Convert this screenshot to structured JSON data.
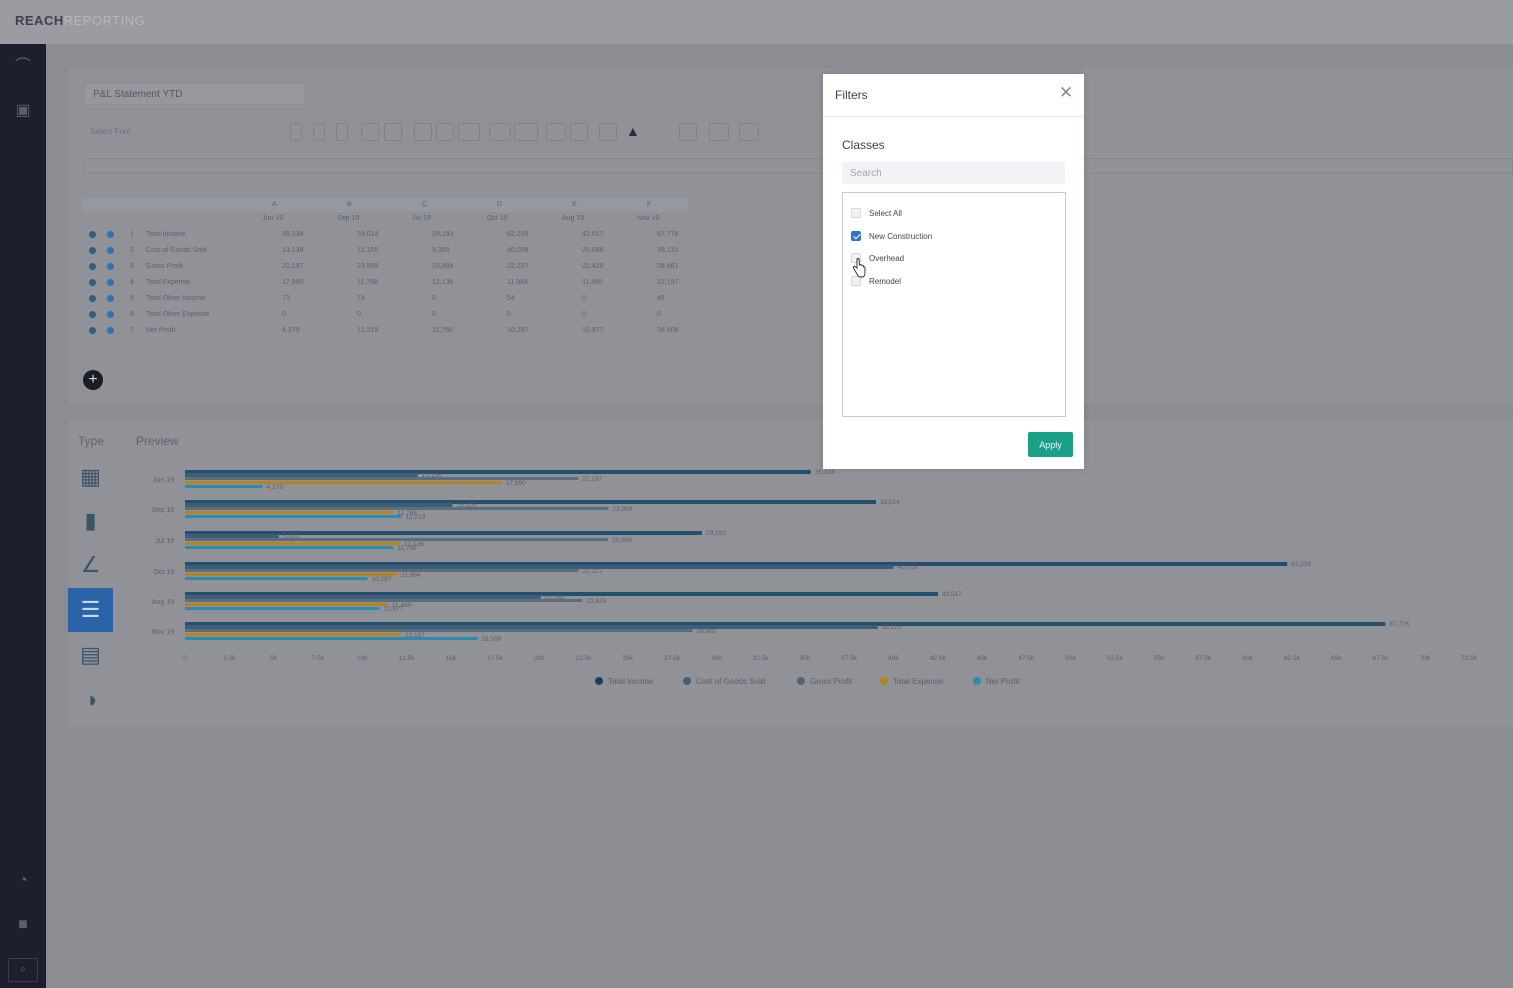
{
  "app": {
    "logo_bold": "REACH",
    "logo_light": "REPORTING"
  },
  "report": {
    "title": "P&L Statement YTD",
    "font_select": "Select Font",
    "columns": [
      "Jun 19",
      "Sep 19",
      "Jul 19",
      "Oct 19",
      "Aug 19",
      "Nov 19"
    ],
    "col_letters": [
      "A",
      "B",
      "C",
      "D",
      "E",
      "F"
    ],
    "rows": [
      {
        "n": "1",
        "label": "Total Income",
        "vals": [
          "35,334",
          "39,014",
          "29,193",
          "62,235",
          "42,517",
          "67,776"
        ]
      },
      {
        "n": "2",
        "label": "Cost of Goods Sold",
        "vals": [
          "13,138",
          "15,105",
          "5,300",
          "40,008",
          "20,088",
          "39,115"
        ]
      },
      {
        "n": "3",
        "label": "Gross Profit",
        "vals": [
          "22,197",
          "23,909",
          "23,888",
          "22,227",
          "22,429",
          "28,661"
        ]
      },
      {
        "n": "4",
        "label": "Total Expense",
        "vals": [
          "17,890",
          "11,768",
          "12,136",
          "11,984",
          "11,465",
          "12,197"
        ]
      },
      {
        "n": "5",
        "label": "Total Other Income",
        "vals": [
          "73",
          "74",
          "0",
          "54",
          "0",
          "46"
        ]
      },
      {
        "n": "6",
        "label": "Total Other Expense",
        "vals": [
          "0",
          "0",
          "0",
          "0",
          "0",
          "0"
        ]
      },
      {
        "n": "7",
        "label": "Net Profit",
        "vals": [
          "4,379",
          "12,219",
          "11,750",
          "10,297",
          "10,977",
          "16,508"
        ]
      }
    ]
  },
  "type_panel": {
    "label": "Type",
    "preview_label": "Preview"
  },
  "type_icons": [
    "table-icon",
    "bar-chart-icon",
    "line-chart-icon",
    "horizontal-bar-icon",
    "stacked-bar-icon",
    "pie-chart-icon"
  ],
  "chart_data": {
    "type": "bar",
    "orientation": "horizontal",
    "categories": [
      "Jun 19",
      "Sep 19",
      "Jul 19",
      "Oct 19",
      "Aug 19",
      "Nov 19"
    ],
    "series": [
      {
        "name": "Total Income",
        "color": "#254f6e",
        "values": [
          35334,
          39014,
          29193,
          62235,
          42517,
          67776
        ],
        "labels": [
          "35,334",
          "39,014",
          "29,193",
          "62,235",
          "42,517",
          "67,776"
        ]
      },
      {
        "name": "Cost of Goods Sold",
        "color": "#3d5d78",
        "values": [
          13138,
          15105,
          5300,
          40008,
          20088,
          39115
        ],
        "labels": [
          "13,138",
          "15,105",
          "5,300",
          "40,008",
          "20,088",
          "39,115"
        ]
      },
      {
        "name": "Gross Profit",
        "color": "#5b6e7c",
        "values": [
          22197,
          23909,
          23888,
          22227,
          22429,
          28661
        ],
        "labels": [
          "22,197",
          "23,909",
          "23,888",
          "22,227",
          "22,429",
          "28,661"
        ]
      },
      {
        "name": "Total Expense",
        "color": "#b8821f",
        "values": [
          17890,
          11768,
          12136,
          11984,
          11465,
          12197
        ],
        "labels": [
          "17,890",
          "11,768",
          "12,136",
          "11,984",
          "11,465",
          "12,197"
        ]
      },
      {
        "name": "Net Profit",
        "color": "#2b8ab0",
        "values": [
          4379,
          12219,
          11750,
          10297,
          10977,
          16508
        ],
        "labels": [
          "4,379",
          "12,219",
          "11,750",
          "10,297",
          "10,977",
          "16,508"
        ]
      }
    ],
    "xlim": [
      0,
      72500
    ],
    "xticks": [
      "0",
      "2.5k",
      "5k",
      "7.5k",
      "10k",
      "12.5k",
      "15k",
      "17.5k",
      "20k",
      "22.5k",
      "25k",
      "27.5k",
      "30k",
      "32.5k",
      "35k",
      "37.5k",
      "40k",
      "42.5k",
      "45k",
      "47.5k",
      "50k",
      "52.5k",
      "55k",
      "57.5k",
      "60k",
      "62.5k",
      "65k",
      "67.5k",
      "70k",
      "72.5k"
    ],
    "legend": "bottom"
  },
  "modal": {
    "title": "Filters",
    "section": "Classes",
    "search_placeholder": "Search",
    "options": [
      {
        "label": "Select All",
        "checked": false
      },
      {
        "label": "New Construction",
        "checked": true
      },
      {
        "label": "Overhead",
        "checked": false
      },
      {
        "label": "Remodel",
        "checked": false
      }
    ],
    "apply_label": "Apply"
  }
}
